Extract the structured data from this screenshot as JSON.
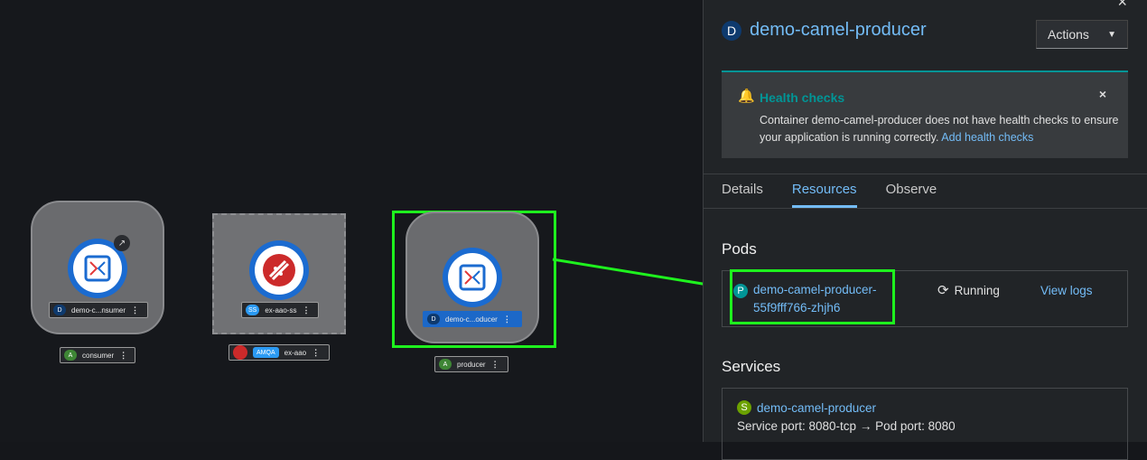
{
  "topology": {
    "consumer_node": {
      "badge": "D",
      "label": "demo-c...nsumer",
      "group_badge": "A",
      "group_label": "consumer"
    },
    "amq_node": {
      "badge": "SS",
      "label": "ex-aao-ss",
      "group_badge": "AMQA",
      "group_label": "ex-aao"
    },
    "producer_node": {
      "badge": "D",
      "label": "demo-c...oducer",
      "group_badge": "A",
      "group_label": "producer"
    }
  },
  "panel": {
    "close": "×",
    "title_badge": "D",
    "title": "demo-camel-producer",
    "actions_label": "Actions",
    "alert": {
      "title": "Health checks",
      "body": "Container demo-camel-producer does not have health checks to ensure your application is running correctly.",
      "link": "Add health checks",
      "close": "×"
    },
    "tabs": [
      "Details",
      "Resources",
      "Observe"
    ],
    "pods": {
      "heading": "Pods",
      "badge": "P",
      "name_line1": "demo-camel-producer-",
      "name_line2": "55f9fff766-zhjh6",
      "status": "Running",
      "logs_link": "View logs"
    },
    "services": {
      "heading": "Services",
      "badge": "S",
      "name": "demo-camel-producer",
      "port_line": "Service port: 8080-tcp → Pod port: 8080"
    }
  },
  "colors": {
    "highlight": "#1ef31e",
    "link": "#73bcf7",
    "accent_teal": "#009596"
  }
}
